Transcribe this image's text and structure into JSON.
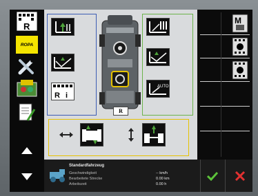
{
  "left": {
    "badge_R": "R",
    "brand_text": "ROPA"
  },
  "main": {
    "center_label": "R"
  },
  "bottom": {
    "vehicle_name": "Standardfahrzeug",
    "rows": [
      {
        "label": "Geschwindigkeit",
        "value": "-- km/h"
      },
      {
        "label": "Bearbeitete Strecke",
        "value": "0.00 km"
      },
      {
        "label": "Arbeitszeit",
        "value": "0.00 h"
      }
    ]
  },
  "icons": {
    "auto_label": "AUTO"
  }
}
